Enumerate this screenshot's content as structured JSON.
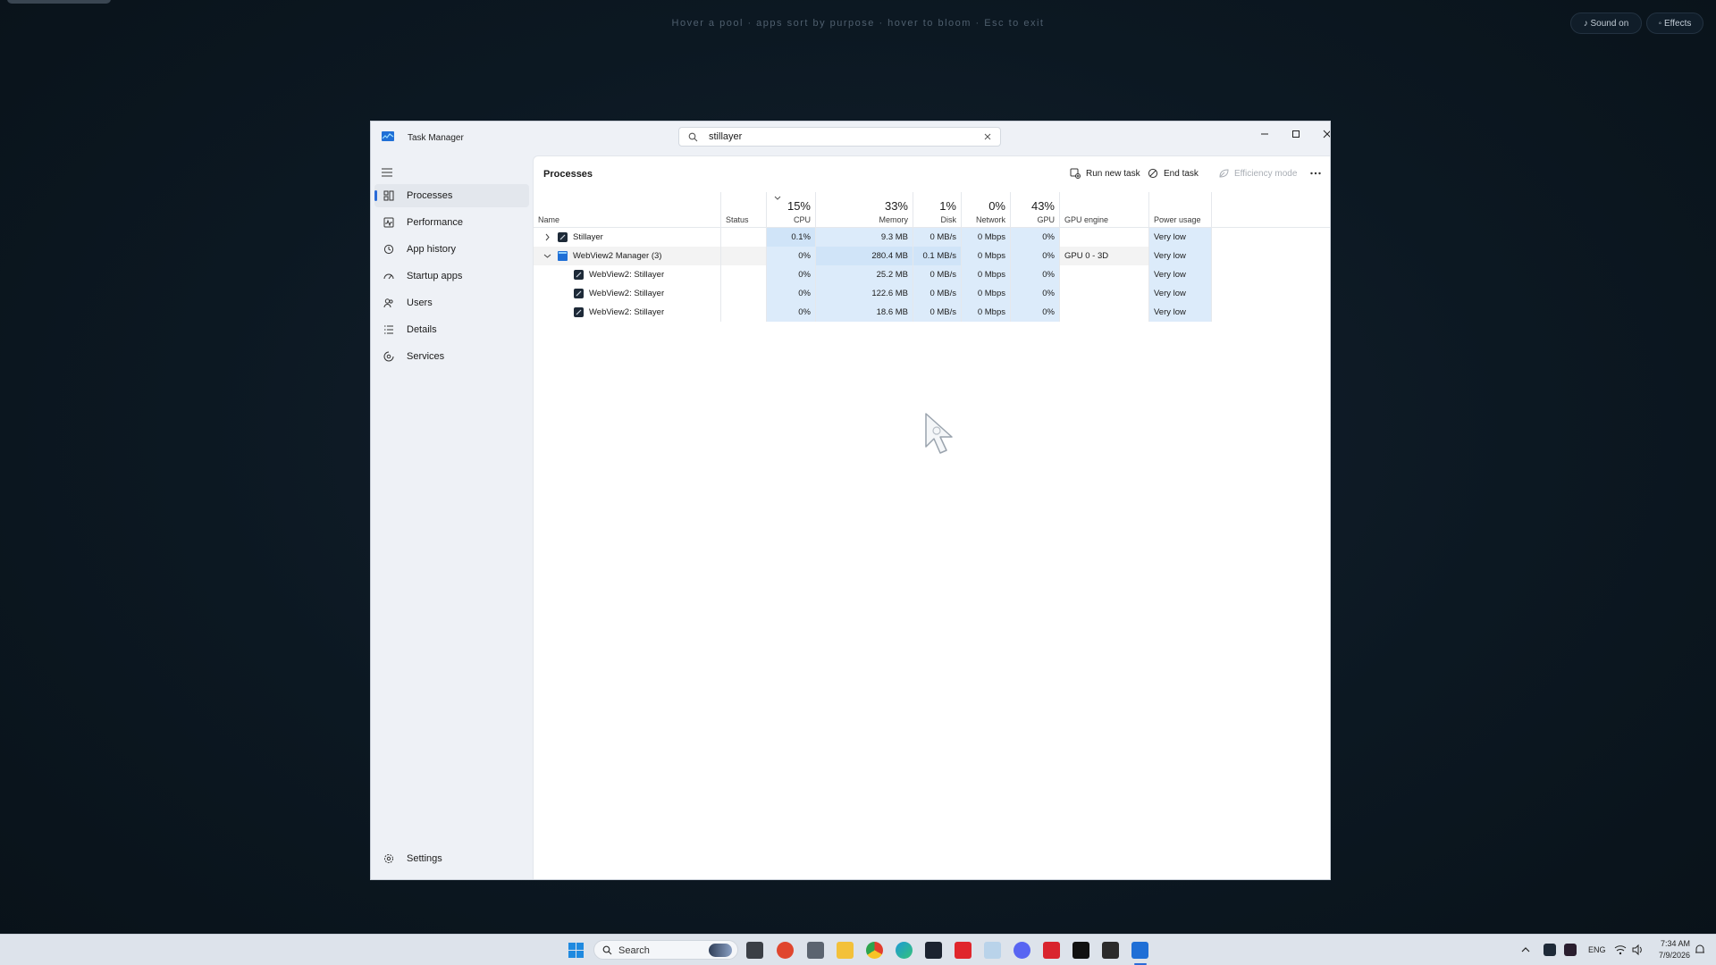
{
  "overlay": {
    "hint": "Hover a pool · apps sort by purpose · hover to bloom · Esc to exit",
    "sound_label": "♪ Sound on",
    "effects_label": "◦ Effects"
  },
  "window": {
    "title": "Task Manager",
    "search_value": "stillayer"
  },
  "sidebar": {
    "items": [
      {
        "label": "Processes",
        "icon": "processes-icon",
        "active": true
      },
      {
        "label": "Performance",
        "icon": "performance-icon"
      },
      {
        "label": "App history",
        "icon": "app-history-icon"
      },
      {
        "label": "Startup apps",
        "icon": "startup-apps-icon"
      },
      {
        "label": "Users",
        "icon": "users-icon"
      },
      {
        "label": "Details",
        "icon": "details-icon"
      },
      {
        "label": "Services",
        "icon": "services-icon"
      }
    ],
    "settings_label": "Settings"
  },
  "content": {
    "title": "Processes",
    "run_new_task": "Run new task",
    "end_task": "End task",
    "efficiency_mode": "Efficiency mode"
  },
  "table": {
    "headers": {
      "name": "Name",
      "status": "Status",
      "cpu": {
        "pct": "15%",
        "label": "CPU"
      },
      "memory": {
        "pct": "33%",
        "label": "Memory"
      },
      "disk": {
        "pct": "1%",
        "label": "Disk"
      },
      "network": {
        "pct": "0%",
        "label": "Network"
      },
      "gpu": {
        "pct": "43%",
        "label": "GPU"
      },
      "gpu_engine": "GPU engine",
      "power_usage": "Power usage"
    },
    "rows": [
      {
        "name": "Stillayer",
        "status": "",
        "cpu": "0.1%",
        "memory": "9.3 MB",
        "disk": "0 MB/s",
        "network": "0 Mbps",
        "gpu": "0%",
        "gpu_engine": "",
        "power": "Very low"
      },
      {
        "name": "WebView2 Manager (3)",
        "status": "",
        "cpu": "0%",
        "memory": "280.4 MB",
        "disk": "0.1 MB/s",
        "network": "0 Mbps",
        "gpu": "0%",
        "gpu_engine": "GPU 0 - 3D",
        "power": "Very low"
      },
      {
        "name": "WebView2: Stillayer",
        "status": "",
        "cpu": "0%",
        "memory": "25.2 MB",
        "disk": "0 MB/s",
        "network": "0 Mbps",
        "gpu": "0%",
        "gpu_engine": "",
        "power": "Very low"
      },
      {
        "name": "WebView2: Stillayer",
        "status": "",
        "cpu": "0%",
        "memory": "122.6 MB",
        "disk": "0 MB/s",
        "network": "0 Mbps",
        "gpu": "0%",
        "gpu_engine": "",
        "power": "Very low"
      },
      {
        "name": "WebView2: Stillayer",
        "status": "",
        "cpu": "0%",
        "memory": "18.6 MB",
        "disk": "0 MB/s",
        "network": "0 Mbps",
        "gpu": "0%",
        "gpu_engine": "",
        "power": "Very low"
      }
    ]
  },
  "taskbar": {
    "search_label": "Search",
    "tray_lang": "ENG",
    "time": "7:34 AM",
    "date": "7/9/2026"
  },
  "colors": {
    "accent": "#2a6bd8",
    "highlight": "#dcebfa"
  }
}
